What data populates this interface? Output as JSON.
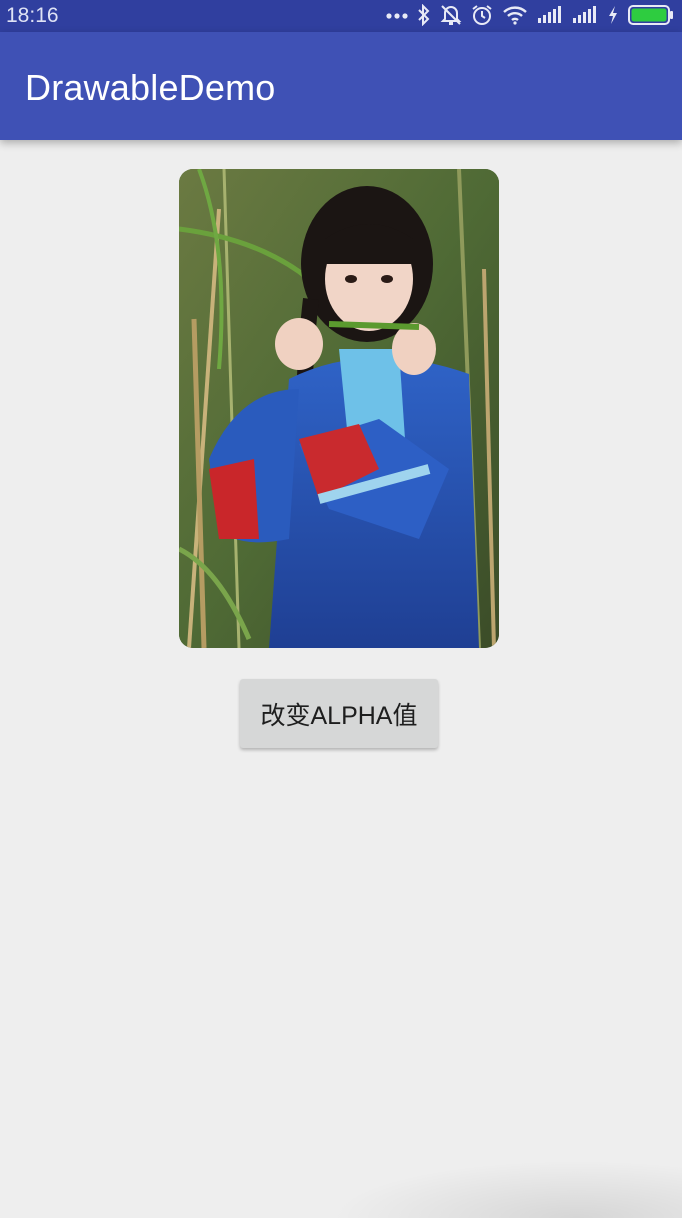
{
  "status_bar": {
    "time": "18:16",
    "icons": [
      "more-dots-icon",
      "bluetooth-icon",
      "alarm-off-icon",
      "alarm-clock-icon",
      "wifi-icon",
      "signal-1-icon",
      "signal-2-icon",
      "charging-icon",
      "battery-icon"
    ],
    "battery_level": 1.0,
    "battery_color": "#2ecc40"
  },
  "app_bar": {
    "title": "DrawableDemo",
    "color": "#3f51b5"
  },
  "content": {
    "image": "portrait-photo",
    "button_label": "改变ALPHA值"
  }
}
